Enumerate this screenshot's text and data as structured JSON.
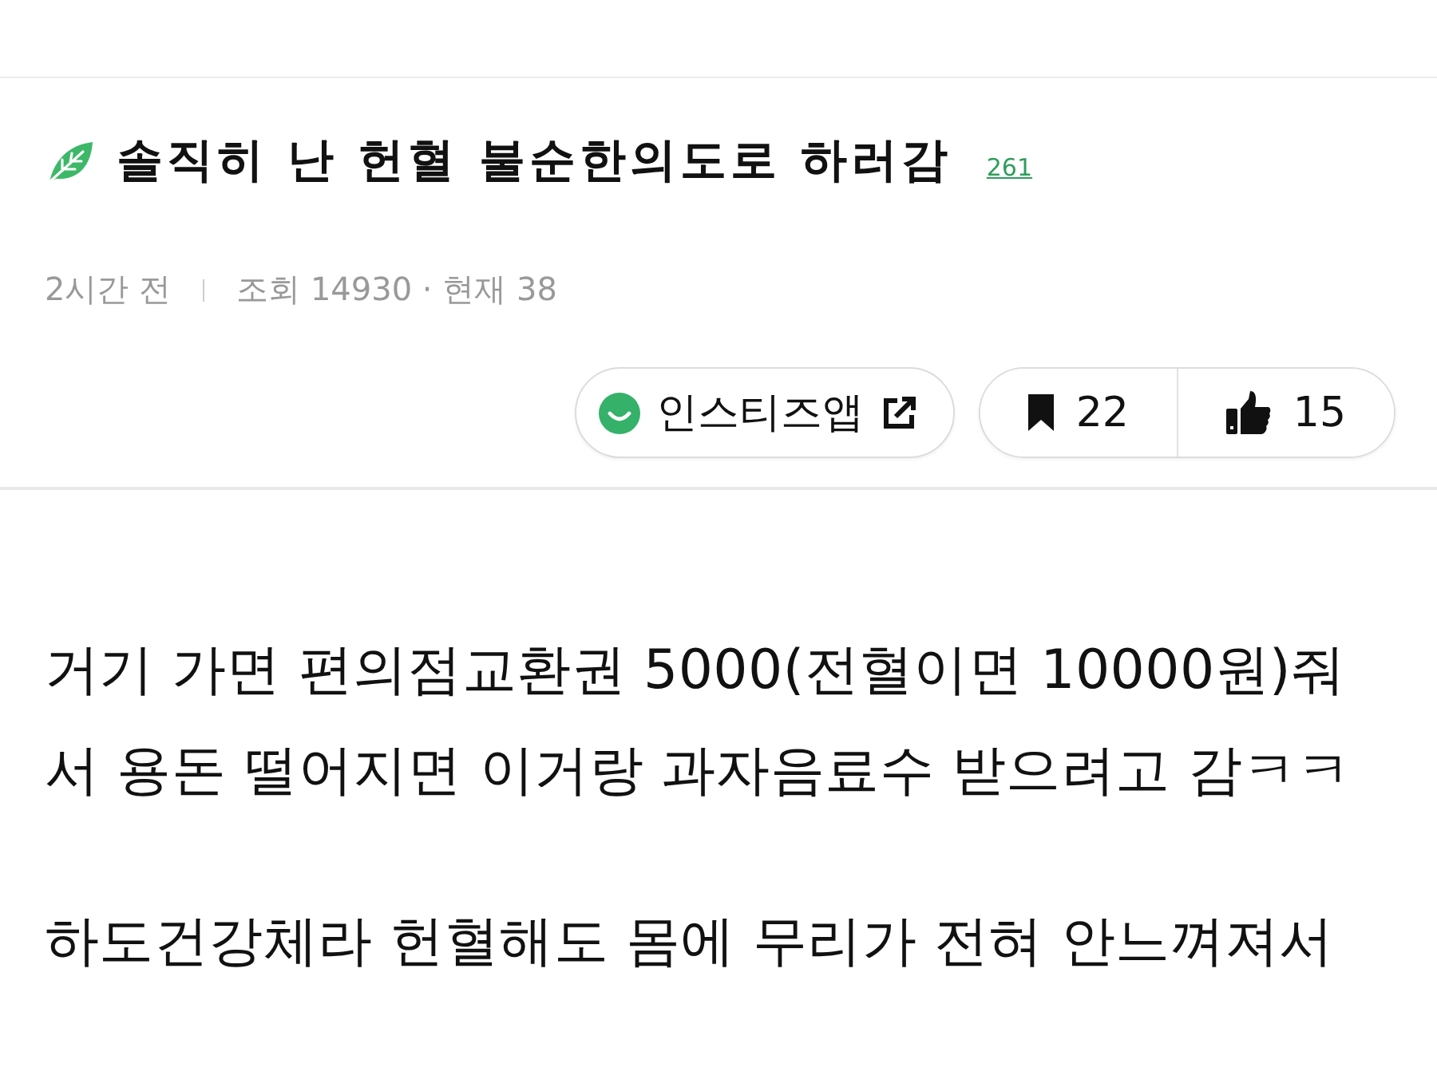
{
  "post": {
    "title": "솔직히 난 헌혈 불순한의도로 하러감",
    "comment_count": "261",
    "time": "2시간 전",
    "views": "조회 14930 · 현재 38"
  },
  "actions": {
    "app_link": "인스티즈앱",
    "bookmarks": "22",
    "likes": "15"
  },
  "body": {
    "paragraphs": [
      "거기 가면 편의점교환권 5000(전혈이면 10000원)줘서 용돈 떨어지면 이거랑 과자음료수 받으려고 감ㅋㅋ",
      "하도건강체라 헌혈해도 몸에 무리가 전혀 안느껴져서"
    ]
  }
}
